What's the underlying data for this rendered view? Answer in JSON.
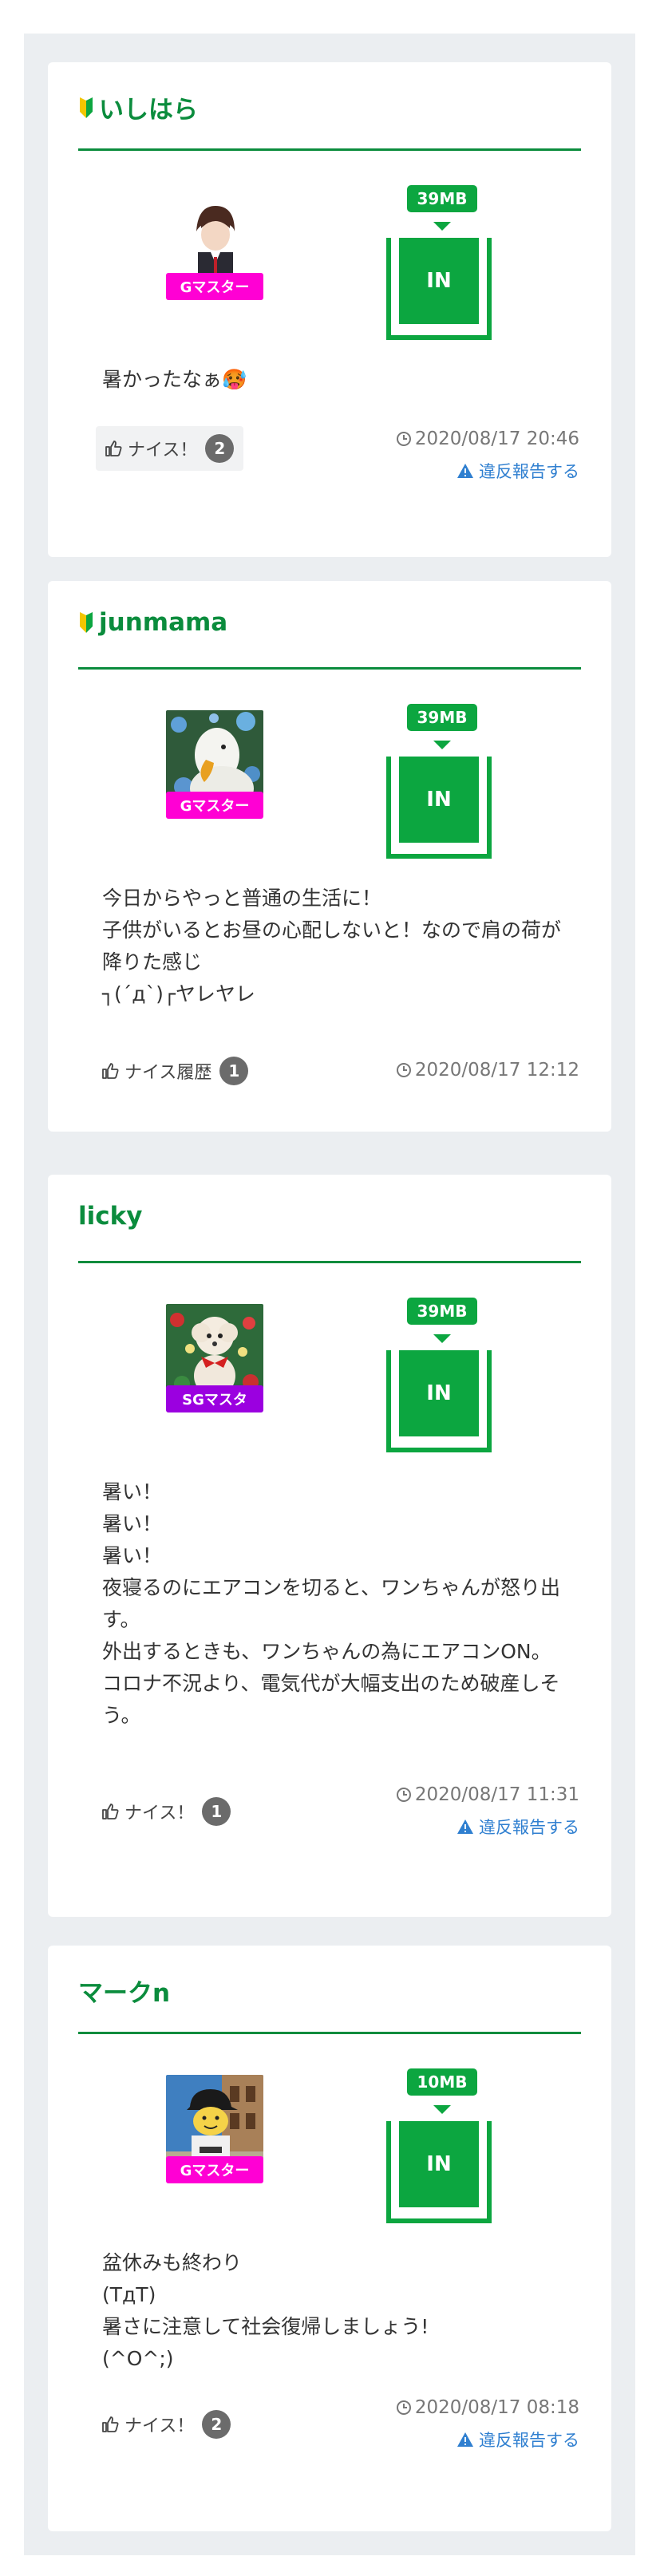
{
  "posts": [
    {
      "name": "いしはら",
      "beginner": true,
      "rank": "Gマスター",
      "rank_color": "#ff00d4",
      "data_size": "39MB",
      "status": "IN",
      "text": "暑かったなぁ🥵",
      "nice_label": "ナイス！",
      "nice_count": "2",
      "date": "2020/08/17 20:46",
      "report": "違反報告する"
    },
    {
      "name": "junmama",
      "beginner": true,
      "rank": "Gマスター",
      "rank_color": "#ff00d4",
      "data_size": "39MB",
      "status": "IN",
      "text": "今日からやっと普通の生活に！\n子供がいるとお昼の心配しないと！なので肩の荷が降りた感じ\n┐(´д`)┌ヤレヤレ",
      "nice_label": "ナイス履歴",
      "nice_count": "1",
      "date": "2020/08/17 12:12"
    },
    {
      "name": "licky",
      "beginner": false,
      "rank": "SGマスタ",
      "rank_color": "#9b00e0",
      "data_size": "39MB",
      "status": "IN",
      "text": "暑い！\n暑い！\n暑い！\n夜寝るのにエアコンを切ると、ワンちゃんが怒り出す。\n外出するときも、ワンちゃんの為にエアコンON。\nコロナ不況より、電気代が大幅支出のため破産しそう。",
      "nice_label": "ナイス！",
      "nice_count": "1",
      "date": "2020/08/17 11:31",
      "report": "違反報告する"
    },
    {
      "name": "マークn",
      "beginner": false,
      "rank": "Gマスター",
      "rank_color": "#ff00d4",
      "data_size": "10MB",
      "status": "IN",
      "text": "盆休みも終わり\n(TдT)\n暑さに注意して社会復帰しましょう!\n(^O^;)",
      "nice_label": "ナイス！",
      "nice_count": "2",
      "date": "2020/08/17 08:18",
      "report": "違反報告する"
    }
  ]
}
